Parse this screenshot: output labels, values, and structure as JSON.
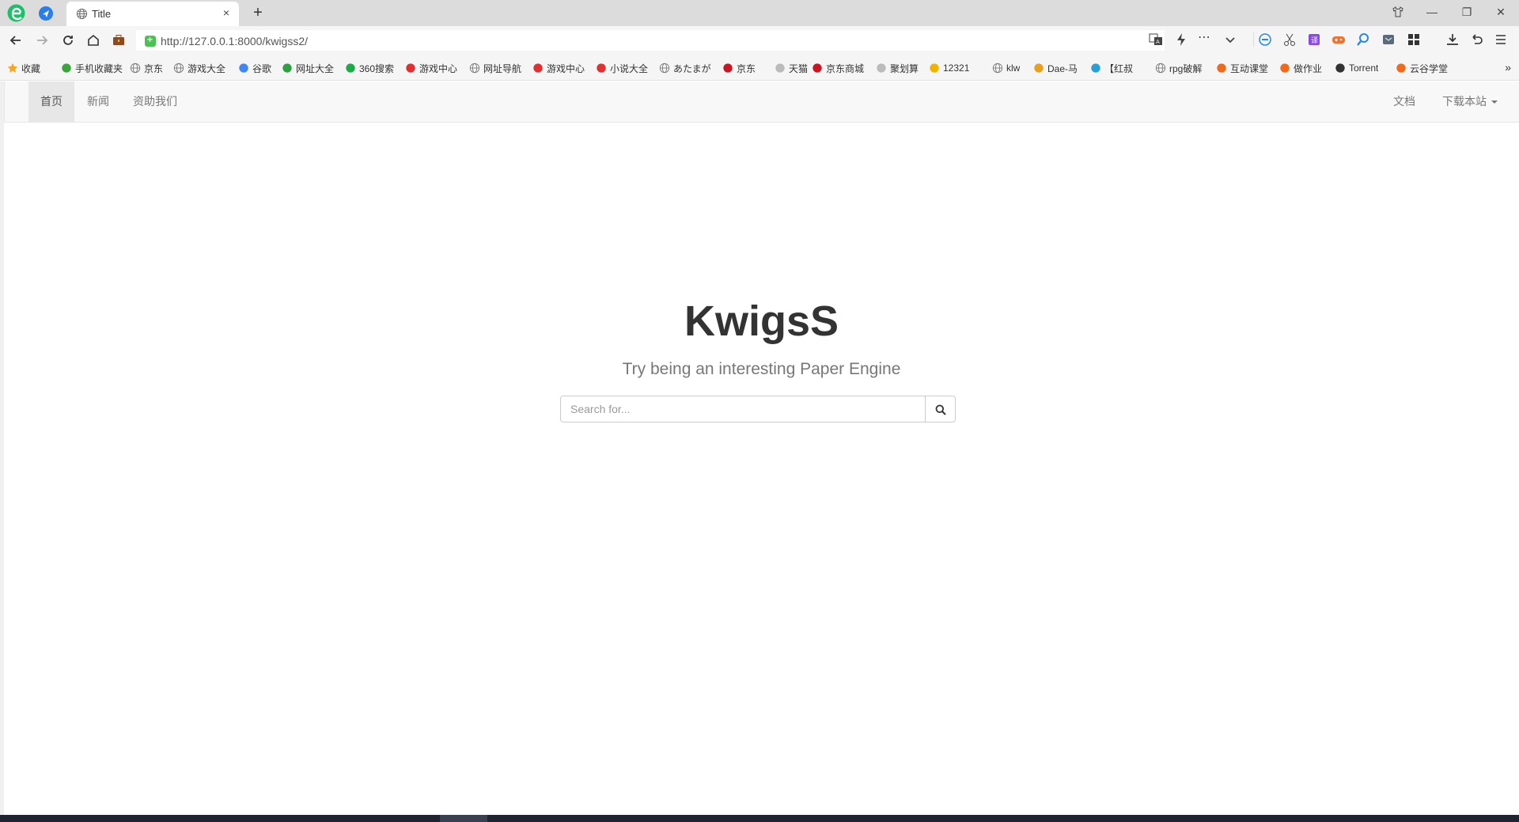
{
  "browser": {
    "tab": {
      "title": "Title",
      "close": "×"
    },
    "new_tab": "+",
    "url": "http://127.0.0.1:8000/kwigss2/",
    "window": {
      "restore": "❐",
      "minimize": "—",
      "maximize": "☐",
      "close": "✕"
    },
    "bookmarks": [
      {
        "label": "收藏",
        "icon": "star-icon",
        "color": "#f5a623"
      },
      {
        "label": "手机收藏夹",
        "icon": "phone-icon",
        "color": "#3aa53a"
      },
      {
        "label": "京东",
        "icon": "globe-icon",
        "color": "#777777"
      },
      {
        "label": "游戏大全",
        "icon": "globe-icon",
        "color": "#777777"
      },
      {
        "label": "谷歌",
        "icon": "google-icon",
        "color": "#4285f4"
      },
      {
        "label": "网址大全",
        "icon": "navigation-icon",
        "color": "#2ea043"
      },
      {
        "label": "360搜索",
        "icon": "search-360-icon",
        "color": "#1eaa4b"
      },
      {
        "label": "游戏中心",
        "icon": "game-center-icon",
        "color": "#e03030"
      },
      {
        "label": "网址导航",
        "icon": "globe-icon",
        "color": "#777777"
      },
      {
        "label": "游戏中心",
        "icon": "game-center-icon",
        "color": "#e03030"
      },
      {
        "label": "小说大全",
        "icon": "novel-icon",
        "color": "#e03030"
      },
      {
        "label": "あたまが",
        "icon": "globe-icon",
        "color": "#777777"
      },
      {
        "label": "京东",
        "icon": "jd-icon",
        "color": "#c81623"
      },
      {
        "label": "天猫",
        "icon": "tmall-icon",
        "color": "#bbbbbb"
      },
      {
        "label": "京东商城",
        "icon": "jd-icon",
        "color": "#c81623"
      },
      {
        "label": "聚划算",
        "icon": "juhuasuan-icon",
        "color": "#bbbbbb"
      },
      {
        "label": "12321",
        "icon": "report-icon",
        "color": "#f0b400"
      },
      {
        "label": "klw",
        "icon": "globe-icon",
        "color": "#777777"
      },
      {
        "label": "Dae-马",
        "icon": "dae-icon",
        "color": "#e8a020"
      },
      {
        "label": "【红叔",
        "icon": "bilibili-icon",
        "color": "#2a9fd6"
      },
      {
        "label": "rpg破解",
        "icon": "globe-icon",
        "color": "#777777"
      },
      {
        "label": "互动课堂",
        "icon": "fox-icon",
        "color": "#f06a1d"
      },
      {
        "label": "做作业",
        "icon": "fox-icon",
        "color": "#f06a1d"
      },
      {
        "label": "Torrent",
        "icon": "torrent-icon",
        "color": "#333333"
      },
      {
        "label": "云谷学堂",
        "icon": "fox-icon",
        "color": "#f06a1d"
      }
    ],
    "bookmarks_more": "»"
  },
  "navbar": {
    "left": [
      {
        "label": "首页",
        "active": true
      },
      {
        "label": "新闻",
        "active": false
      },
      {
        "label": "资助我们",
        "active": false
      }
    ],
    "right": [
      {
        "label": "文档"
      },
      {
        "label": "下载本站"
      }
    ]
  },
  "hero": {
    "title": "KwigsS",
    "subtitle": "Try being an interesting Paper Engine",
    "search": {
      "placeholder": "Search for...",
      "value": "",
      "button_icon": "search-icon"
    }
  },
  "colors": {
    "accent_green": "#4cbf55",
    "navbar_bg": "#f8f8f8",
    "active_nav_bg": "#e7e7e7"
  }
}
